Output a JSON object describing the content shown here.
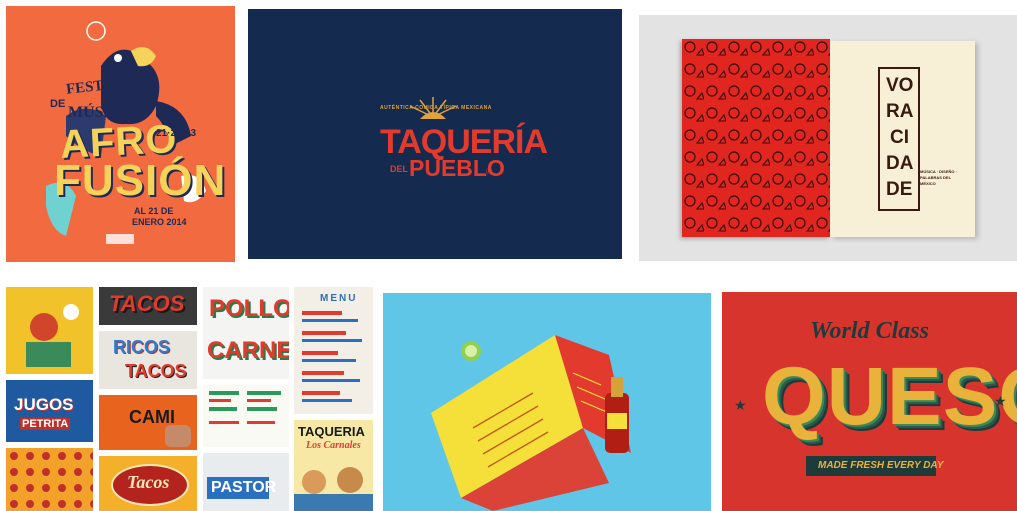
{
  "poster": {
    "line1": "FESTIVAL",
    "line2": "DE",
    "line3": "MÚSICA",
    "line4": "AFRO",
    "line5": "FUSIÓN",
    "dates": "21·22·23",
    "venue": "AL 21 DE",
    "month": "ENERO 2014"
  },
  "taqueria": {
    "arc": "AUTÉNTICA COMIDA TÍPICA MEXICANA",
    "main": "TAQUERÍA",
    "small": "DEL",
    "sub": "PUEBLO",
    "tm": "®"
  },
  "magazine": {
    "title_lines": [
      "VO",
      "RA",
      "CI",
      "DA",
      "DE"
    ],
    "caption": "MÚSICA · DISEÑO · PALABRAS DEL MÉXICO"
  },
  "collage": {
    "tacos1": "TACOS",
    "pollo": "POLLO",
    "carne": "CARNE",
    "menu": "MENU",
    "ricos": "RICOS",
    "tacos2": "TACOS",
    "jugos": "JUGOS",
    "petrita": "PETRITA",
    "cami": "CAMI",
    "taqueria": "TAQUERIA",
    "carnales": "Los Carnales",
    "tacos3": "Tacos",
    "pastor": "PASTOR"
  },
  "queso": {
    "top": "World Class",
    "main": "QUESO",
    "banner": "MADE FRESH EVERY DAY"
  },
  "colors": {
    "poster_bg": "#f26a3f",
    "taqueria_bg": "#142a4e",
    "magazine_red": "#e0261f",
    "menu_bg": "#5fc6e8",
    "queso_bg": "#d8342e"
  }
}
